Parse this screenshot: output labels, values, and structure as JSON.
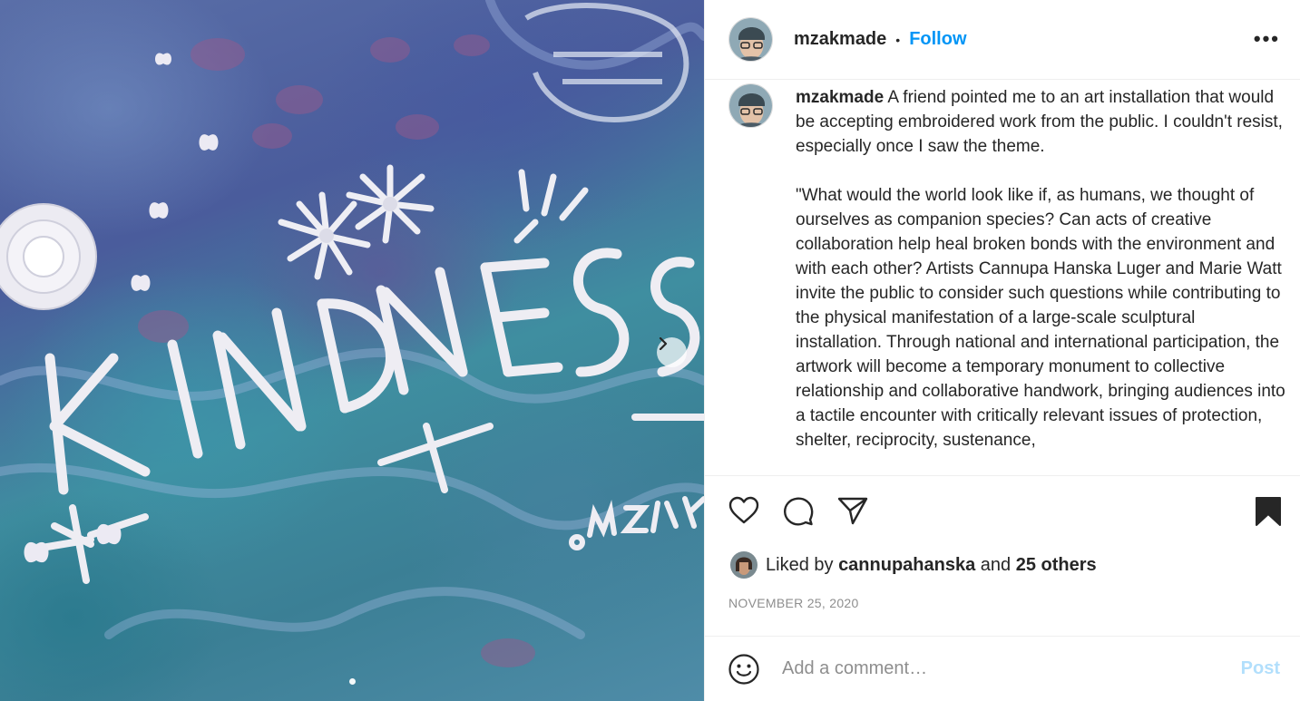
{
  "post": {
    "username": "mzakmade",
    "separator": "•",
    "follow_label": "Follow",
    "more_label": "•••",
    "caption_username": "mzakmade",
    "caption_paragraphs": [
      "A friend pointed me to an art installation that would be accepting embroidered work from the public. I couldn't resist, especially once I saw the theme.",
      "\"What would the world look like if, as humans, we thought of ourselves as companion species? Can acts of creative collaboration help heal broken bonds with the environment and with each other? Artists Cannupa Hanska Luger and Marie Watt invite the public to consider such questions while contributing to the physical manifestation of a large-scale sculptural installation. Through national and international participation, the artwork will become a temporary monument to collective relationship and collaborative handwork, bringing audiences into a tactile encounter with critically relevant issues of protection, shelter, reciprocity, sustenance,"
    ],
    "likes": {
      "prefix": "Liked by",
      "user": "cannupahanska",
      "middle": "and",
      "others": "25 others"
    },
    "date": "NOVEMBER 25, 2020",
    "comment_placeholder": "Add a comment…",
    "post_label": "Post",
    "carousel": {
      "current": 1,
      "total": 2
    }
  },
  "icons": {
    "like": "heart-icon",
    "comment": "comment-icon",
    "share": "share-icon",
    "save": "bookmark-icon",
    "emoji": "emoji-icon",
    "next": "chevron-right-icon",
    "more": "more-options-icon"
  },
  "colors": {
    "follow": "#0095f6",
    "post_disabled": "#b2dffc",
    "text": "#262626",
    "muted": "#8e8e8e"
  }
}
